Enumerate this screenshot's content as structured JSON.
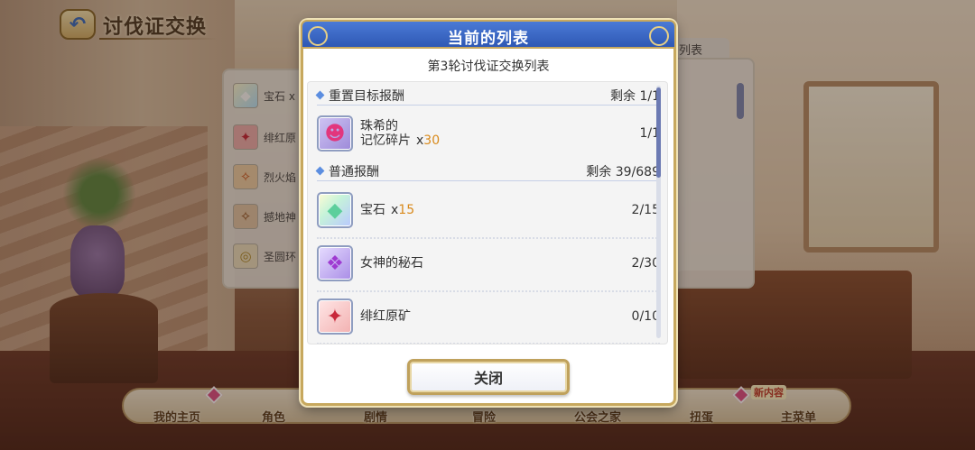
{
  "screen": {
    "title": "讨伐证交换",
    "back_icon": "back-arrow-icon",
    "right_tab_label": "列表"
  },
  "underlying_list": [
    {
      "label": "宝石 x",
      "icon": "gem-icon"
    },
    {
      "label": "绯红原",
      "icon": "crimson-ore-icon"
    },
    {
      "label": "烈火焰",
      "icon": "fire-shard-icon"
    },
    {
      "label": "撼地神",
      "icon": "earth-shard-icon"
    },
    {
      "label": "圣圆环",
      "icon": "holy-ring-icon"
    }
  ],
  "modal": {
    "title": "当前的列表",
    "subtitle": "第3轮讨伐证交换列表",
    "sections": [
      {
        "label": "重置目标报酬",
        "remain": "剩余 1/1",
        "items": [
          {
            "name_line1": "珠希的",
            "name_line2": "记忆碎片",
            "qty_prefix": "x",
            "qty": "30",
            "count": "1/1",
            "icon": "character-portrait-icon"
          }
        ]
      },
      {
        "label": "普通报酬",
        "remain": "剩余 39/689",
        "items": [
          {
            "name": "宝石",
            "qty_prefix": "x",
            "qty": "15",
            "count": "2/15",
            "icon": "gem-icon"
          },
          {
            "name": "女神的秘石",
            "count": "2/30",
            "icon": "goddess-stone-icon"
          },
          {
            "name": "绯红原矿",
            "count": "0/10",
            "icon": "crimson-ore-icon"
          }
        ]
      }
    ],
    "close_label": "关闭"
  },
  "bottom_nav": [
    {
      "label": "我的主页"
    },
    {
      "label": "角色"
    },
    {
      "label": "剧情"
    },
    {
      "label": "冒险"
    },
    {
      "label": "公会之家"
    },
    {
      "label": "扭蛋"
    },
    {
      "label": "主菜单"
    }
  ],
  "new_content_tag": "新内容",
  "colors": {
    "modal_header": "#2f58b4",
    "modal_border": "#c7a85e",
    "quantity_highlight": "#d98a1c",
    "section_marker": "#5c8ee0"
  }
}
